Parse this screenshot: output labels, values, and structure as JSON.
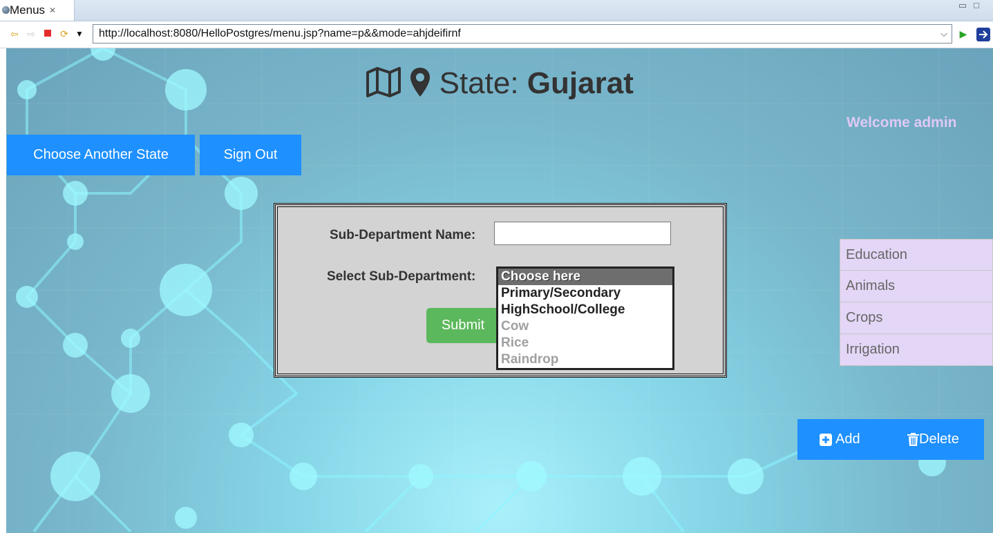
{
  "window": {
    "tab_title": "Menus",
    "tab_close": "✕",
    "url": "http://localhost:8080/HelloPostgres/menu.jsp?name=p&&mode=ahjdeifirnf"
  },
  "header": {
    "state_label": "State: ",
    "state_name": "Gujarat",
    "welcome": "Welcome admin"
  },
  "nav": {
    "choose_state": "Choose Another State",
    "sign_out": "Sign Out"
  },
  "form": {
    "name_label": "Sub-Department Name:",
    "name_value": "",
    "select_label": "Select Sub-Department:",
    "submit_label": "Submit",
    "options": [
      {
        "label": "Choose here",
        "state": "selected"
      },
      {
        "label": "Primary/Secondary",
        "state": "enabled"
      },
      {
        "label": "HighSchool/College",
        "state": "enabled"
      },
      {
        "label": "Cow",
        "state": "disabled"
      },
      {
        "label": "Rice",
        "state": "disabled"
      },
      {
        "label": "Raindrop",
        "state": "disabled"
      }
    ]
  },
  "sidebar": {
    "items": [
      {
        "label": "Education"
      },
      {
        "label": "Animals"
      },
      {
        "label": "Crops"
      },
      {
        "label": "Irrigation"
      }
    ]
  },
  "actions": {
    "add_label": "Add",
    "delete_label": "Delete"
  },
  "colors": {
    "primary_blue": "#1e90ff",
    "submit_green": "#5cb85c",
    "sidebar_lavender": "#e4d6f6",
    "welcome_text": "#dfc9f5"
  }
}
